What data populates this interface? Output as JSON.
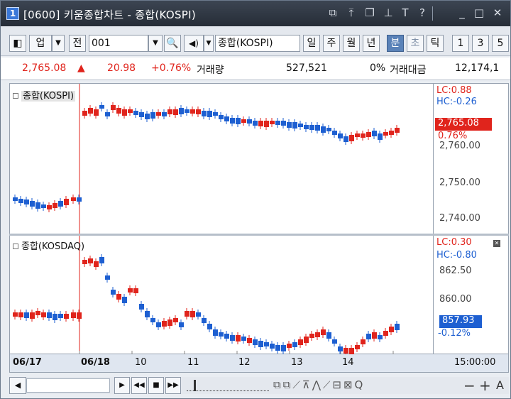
{
  "window": {
    "number": "1",
    "title": "[0600] 키움종합차트 - 종합(KOSPI)",
    "icons": [
      "restore-window-icon",
      "pin-top-icon",
      "copy-window-icon",
      "pin-icon",
      "font-icon",
      "help-icon",
      "minimize-icon",
      "maximize-icon",
      "close-icon"
    ]
  },
  "toolbar": {
    "market_label": "업",
    "prev_label": "전",
    "code_value": "001",
    "name_value": "종합(KOSPI)",
    "periods": [
      "일",
      "주",
      "월",
      "년",
      "분",
      "초",
      "틱"
    ],
    "selected_period": "분",
    "intervals": [
      "1",
      "3",
      "5"
    ]
  },
  "price": {
    "last": "2,765.08",
    "arrow": "▲",
    "change": "20.98",
    "change_pct": "+0.76%",
    "volume_label": "거래량",
    "volume": "527,521",
    "volume_pct": "0%",
    "amount_label": "거래대금",
    "amount": "12,174,1"
  },
  "upper_panel": {
    "title": "종합(KOSPI)",
    "lc": "LC:0.88",
    "hc": "HC:-0.26",
    "price_tag": "2,765.08",
    "price_pct": "0.76%",
    "ticks": [
      "2,760.00",
      "2,750.00",
      "2,740.00"
    ]
  },
  "lower_panel": {
    "title": "종합(KOSDAQ)",
    "lc": "LC:0.30",
    "hc": "HC:-0.80",
    "price_tag": "857.93",
    "price_pct": "-0.12%",
    "ticks": [
      "862.50",
      "860.00"
    ]
  },
  "date_axis": {
    "labels": [
      "06/17",
      "06/18",
      "10",
      "11",
      "12",
      "13",
      "14"
    ],
    "time_label": "15:00:00"
  },
  "colors": {
    "up": "#e0241c",
    "down": "#1d5fd1",
    "tag_up": "#e0241c",
    "tag_down": "#1d5fd1"
  }
}
